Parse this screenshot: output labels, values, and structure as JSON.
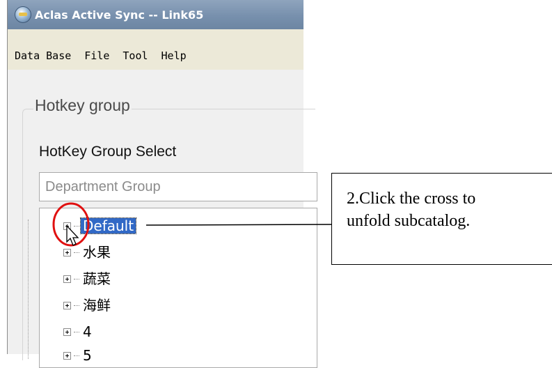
{
  "window": {
    "title": "Aclas Active Sync -- Link65"
  },
  "menu": {
    "items": [
      "Data Base",
      "File",
      "Tool",
      "Help"
    ]
  },
  "hotkey_group": {
    "legend": "Hotkey group",
    "select_label": "HotKey Group Select",
    "selected_value": "Department Group"
  },
  "tree": {
    "nodes": [
      "Default",
      "水果",
      "蔬菜",
      "海鲜",
      "4",
      "5"
    ],
    "selected_index": 0
  },
  "callout": {
    "lines": [
      "2.Click the cross to",
      "unfold subcatalog."
    ]
  },
  "colors": {
    "selection": "#3169c6",
    "highlight_circle": "#e01010",
    "titlebar": "#7790ad"
  }
}
